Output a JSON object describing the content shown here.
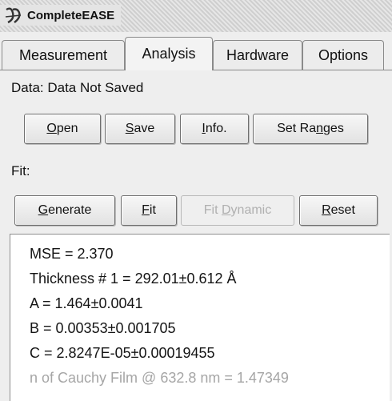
{
  "window": {
    "title": "CompleteEASE",
    "icon": "ellipsometer-logo-icon"
  },
  "tabs": [
    {
      "label": "Measurement",
      "active": false
    },
    {
      "label": "Analysis",
      "active": true
    },
    {
      "label": "Hardware",
      "active": false
    },
    {
      "label": "Options",
      "active": false
    }
  ],
  "data_section": {
    "label": "Data: Data Not Saved",
    "buttons": {
      "open": {
        "pre": "",
        "key": "O",
        "post": "pen"
      },
      "save": {
        "pre": "",
        "key": "S",
        "post": "ave"
      },
      "info": {
        "pre": "",
        "key": "I",
        "post": "nfo."
      },
      "set_ranges": {
        "pre": "Set Ra",
        "key": "n",
        "post": "ges"
      }
    }
  },
  "fit_section": {
    "label": "Fit:",
    "buttons": {
      "generate": {
        "pre": "",
        "key": "G",
        "post": "enerate"
      },
      "fit": {
        "pre": "",
        "key": "F",
        "post": "it"
      },
      "fit_dynamic": {
        "pre": "Fit ",
        "key": "D",
        "post": "ynamic",
        "disabled": true
      },
      "reset": {
        "pre": "",
        "key": "R",
        "post": "eset"
      }
    }
  },
  "results": {
    "lines": [
      "MSE = 2.370",
      "Thickness # 1 = 292.01±0.612 Å",
      "A = 1.464±0.0041",
      "B = 0.00353±0.001705",
      "C = 2.8247E-05±0.00019455",
      "n of Cauchy Film @ 632.8 nm = 1.47349"
    ]
  }
}
